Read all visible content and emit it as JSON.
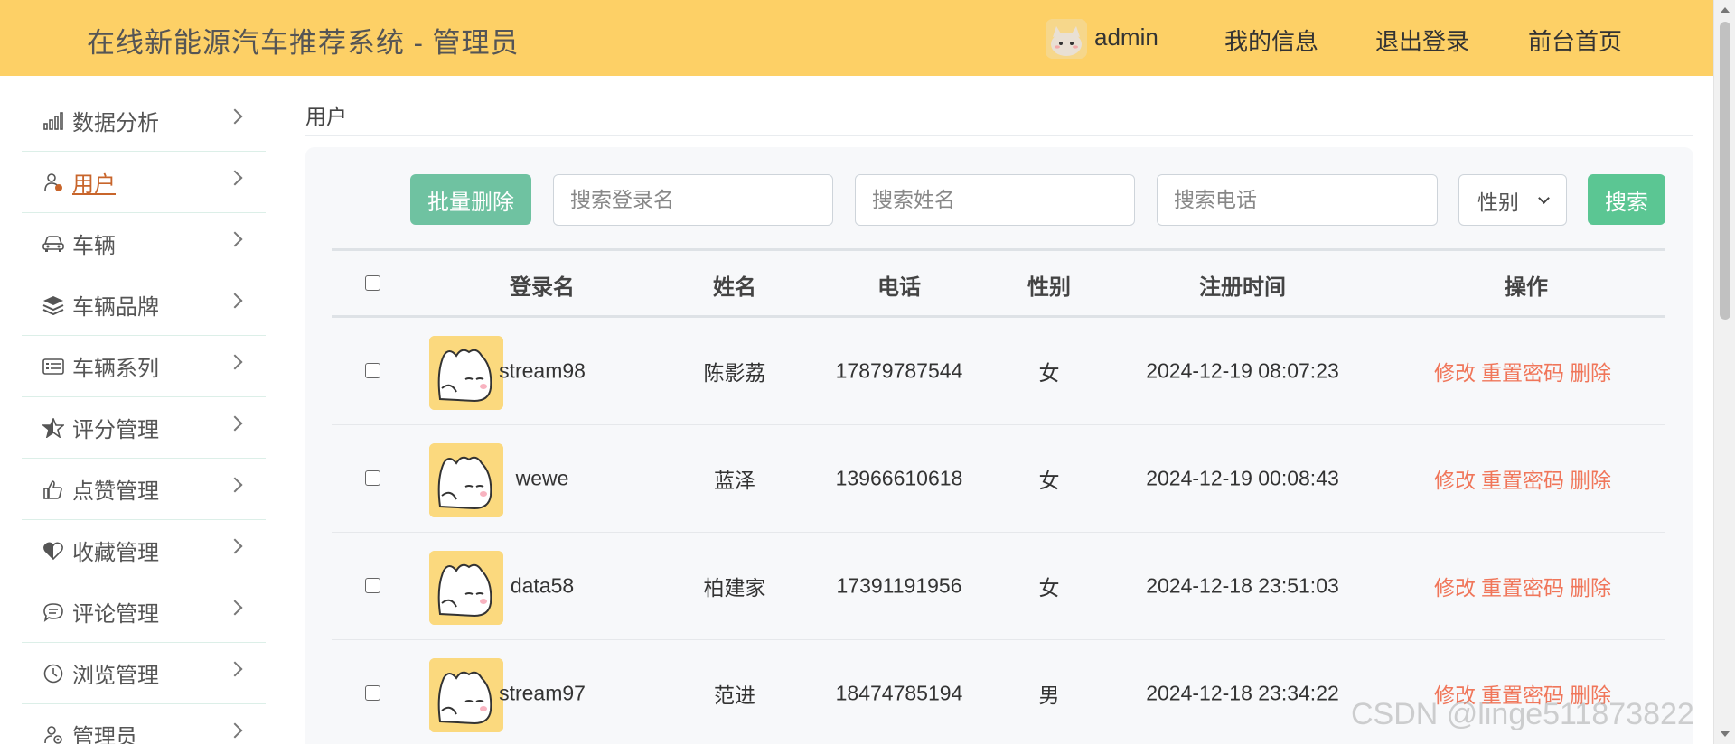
{
  "header": {
    "title": "在线新能源汽车推荐系统 - 管理员",
    "username": "admin",
    "links": [
      "我的信息",
      "退出登录",
      "前台首页"
    ]
  },
  "sidebar": {
    "items": [
      {
        "label": "数据分析",
        "icon": "bar-chart-icon"
      },
      {
        "label": "用户",
        "icon": "user-icon"
      },
      {
        "label": "车辆",
        "icon": "car-icon"
      },
      {
        "label": "车辆品牌",
        "icon": "layers-icon"
      },
      {
        "label": "车辆系列",
        "icon": "list-card-icon"
      },
      {
        "label": "评分管理",
        "icon": "star-icon"
      },
      {
        "label": "点赞管理",
        "icon": "thumb-up-icon"
      },
      {
        "label": "收藏管理",
        "icon": "heart-shield-icon"
      },
      {
        "label": "评论管理",
        "icon": "comment-icon"
      },
      {
        "label": "浏览管理",
        "icon": "clock-icon"
      },
      {
        "label": "管理员",
        "icon": "admin-icon"
      }
    ],
    "active_index": 1
  },
  "breadcrumb": "用户",
  "toolbar": {
    "batch_delete": "批量删除",
    "search_login_placeholder": "搜索登录名",
    "search_name_placeholder": "搜索姓名",
    "search_phone_placeholder": "搜索电话",
    "gender_select": "性别",
    "search_button": "搜索"
  },
  "table": {
    "headers": [
      "登录名",
      "姓名",
      "电话",
      "性别",
      "注册时间",
      "操作"
    ],
    "rows": [
      {
        "login": "stream98",
        "name": "陈影荔",
        "phone": "17879787544",
        "gender": "女",
        "registered": "2024-12-19 08:07:23"
      },
      {
        "login": "wewe",
        "name": "蓝泽",
        "phone": "13966610618",
        "gender": "女",
        "registered": "2024-12-19 00:08:43"
      },
      {
        "login": "data58",
        "name": "柏建家",
        "phone": "17391191956",
        "gender": "女",
        "registered": "2024-12-18 23:51:03"
      },
      {
        "login": "stream97",
        "name": "范进",
        "phone": "18474785194",
        "gender": "男",
        "registered": "2024-12-18 23:34:22"
      }
    ],
    "actions": {
      "edit": "修改",
      "reset": "重置密码",
      "delete": "删除"
    }
  },
  "watermark": "CSDN @linge511873822",
  "colors": {
    "header_bg": "#fdd066",
    "active_menu": "#c8652b",
    "batch_btn": "#6fc2a1",
    "search_btn": "#5bc693",
    "action_link": "#f0765a",
    "avatar_bg": "#fbd97e"
  }
}
